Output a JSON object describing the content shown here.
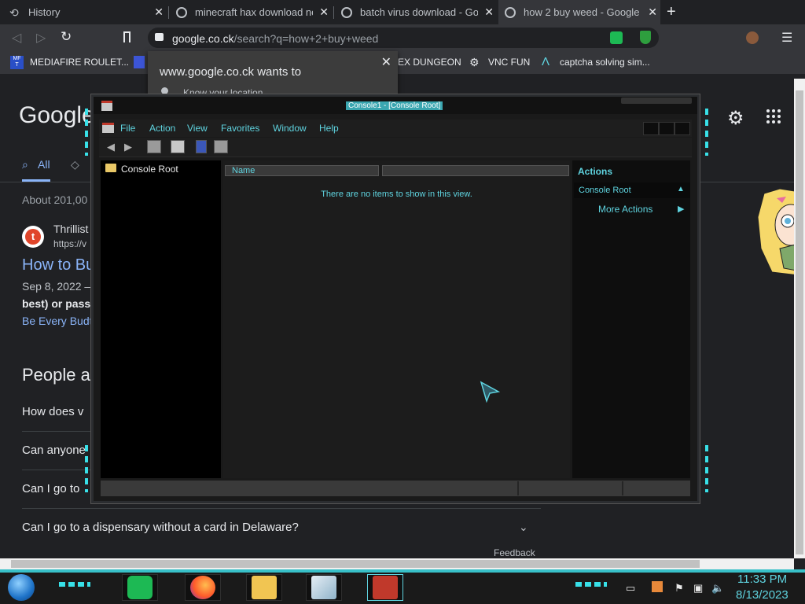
{
  "browser": {
    "tabs": [
      {
        "title": "History",
        "active": false
      },
      {
        "title": "minecraft hax download no v",
        "active": false
      },
      {
        "title": "batch virus download - Goog",
        "active": false
      },
      {
        "title": "how 2 buy weed - Google Se",
        "active": true
      }
    ],
    "new_tab_label": "+",
    "url_host": "google.co.ck",
    "url_path": "/search?q=how+2+buy+weed",
    "bookmarks": [
      "MEDIAFIRE ROULET...",
      "EX DUNGEON",
      "VNC FUN",
      "captcha solving sim..."
    ],
    "permission_popup": {
      "title": "www.google.co.ck wants to",
      "item": "Know your location",
      "close": "✕"
    }
  },
  "google": {
    "logo": "Google",
    "tab_all": "All",
    "about": "About 201,00",
    "result": {
      "site": "Thrillist",
      "site_url": "https://v",
      "title": "How to Bu",
      "date": "Sep 8, 2022 –",
      "snippet_bold": "best) or pass",
      "link": "Be Every Budt"
    },
    "people_also_ask": "People a",
    "questions": [
      "How does v",
      "Can anyone",
      "Can I go to",
      "Can I go to a dispensary without a card in Delaware?"
    ],
    "feedback": "Feedback"
  },
  "mmc": {
    "title": "Console1 - [Console Root]",
    "menu": [
      "File",
      "Action",
      "View",
      "Favorites",
      "Window",
      "Help"
    ],
    "tree_root": "Console Root",
    "column_name": "Name",
    "empty_message": "There are no items to show in this view.",
    "actions_title": "Actions",
    "actions_section": "Console Root",
    "more_actions": "More Actions"
  },
  "taskbar": {
    "time": "11:33 PM",
    "date": "8/13/2023"
  },
  "colors": {
    "accent_cyan": "#5fd4e0",
    "chrome_bg": "#202124",
    "link_blue": "#8ab4f8"
  }
}
